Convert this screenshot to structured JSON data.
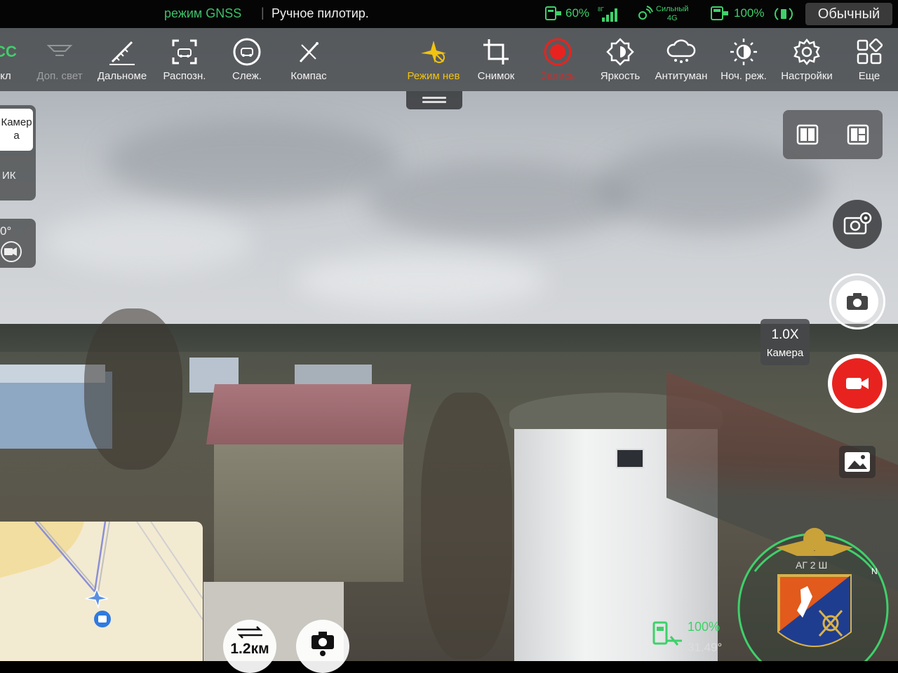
{
  "status_bar": {
    "gnss_mode": "режим GNSS",
    "separator": "|",
    "flight_mode": "Ручное пилотир.",
    "controller_battery": "60%",
    "signal_top": "Сильный",
    "signal_bottom": "4G",
    "drone_battery": "100%",
    "profile": "Обычный"
  },
  "toolbar": {
    "items": [
      {
        "label": "кл",
        "icon": "ccc-icon"
      },
      {
        "label": "Доп. свет",
        "icon": "aux-light-icon"
      },
      {
        "label": "Дальноме",
        "icon": "rangefinder-icon"
      },
      {
        "label": "Распозн.",
        "icon": "recognition-icon"
      },
      {
        "label": "Слеж.",
        "icon": "tracking-icon"
      },
      {
        "label": "Компас",
        "icon": "compass-icon"
      },
      {
        "label": "Режим нев",
        "icon": "stealth-mode-icon"
      },
      {
        "label": "Снимок",
        "icon": "snapshot-icon"
      },
      {
        "label": "Запись",
        "icon": "record-icon"
      },
      {
        "label": "Яркость",
        "icon": "brightness-icon"
      },
      {
        "label": "Антитуман",
        "icon": "defog-icon"
      },
      {
        "label": "Ноч. реж.",
        "icon": "night-mode-icon"
      },
      {
        "label": "Настройки",
        "icon": "settings-icon"
      },
      {
        "label": "Еще",
        "icon": "more-icon"
      }
    ]
  },
  "left_panel": {
    "camera_label": "Камер а",
    "ir_label": "ИК",
    "gimbal_angle": "0°"
  },
  "right_panel": {
    "zoom_value": "1.0X",
    "zoom_label": "Камера"
  },
  "map": {
    "distance": "1.2км"
  },
  "telemetry": {
    "battery": "100%",
    "angle": "31.49°"
  },
  "emblem": {
    "text": "АГ 2 Ш"
  },
  "colors": {
    "status_green": "#3fd06a",
    "record_red": "#e8231f",
    "stealth_yellow": "#f1c40f",
    "toolbar_bg": "#46484a"
  }
}
